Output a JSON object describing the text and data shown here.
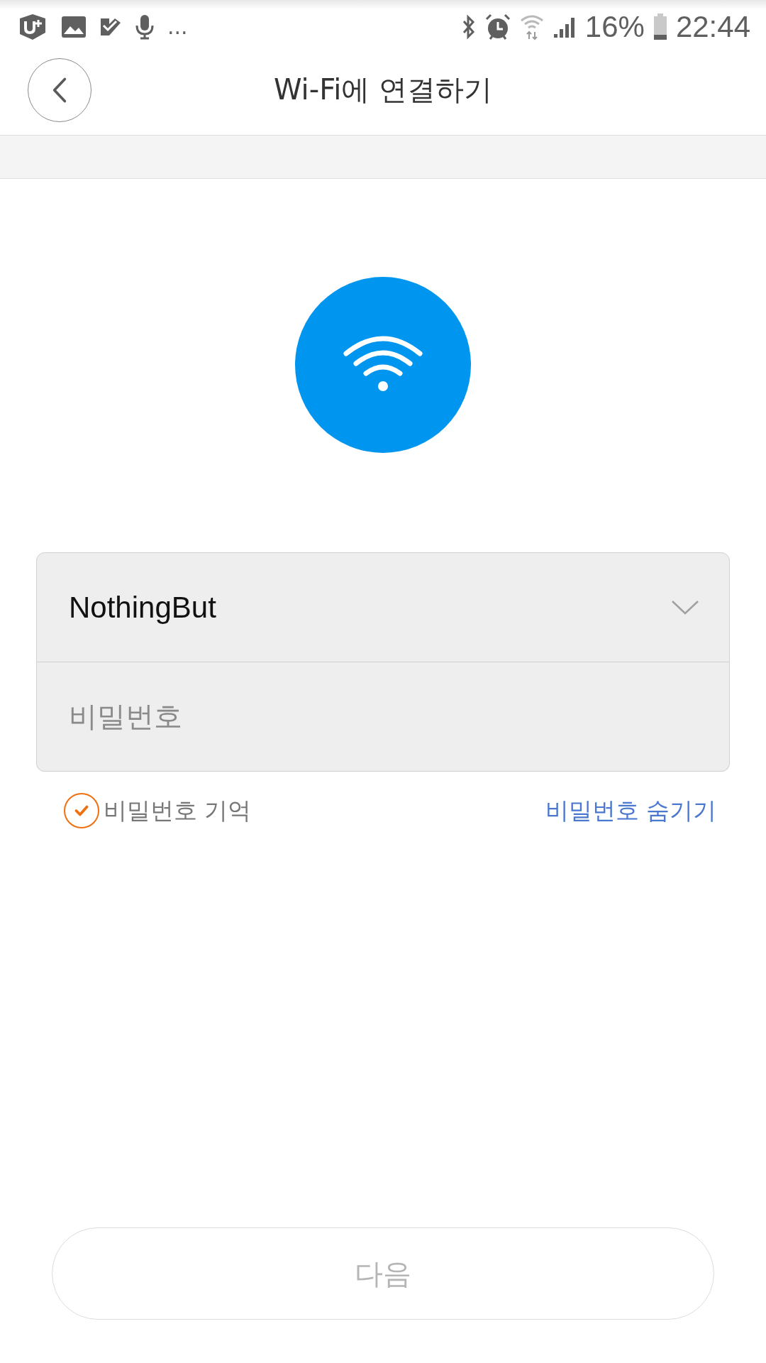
{
  "status_bar": {
    "overflow": "...",
    "battery": "16%",
    "time": "22:44"
  },
  "header": {
    "title": "Wi-Fi에 연결하기"
  },
  "form": {
    "network": "NothingBut",
    "password": {
      "placeholder": "비밀번호"
    },
    "remember": {
      "label": "비밀번호 기억",
      "checked": true
    },
    "toggle_link": "비밀번호 숨기기"
  },
  "next_button": {
    "label": "다음",
    "disabled": true
  }
}
